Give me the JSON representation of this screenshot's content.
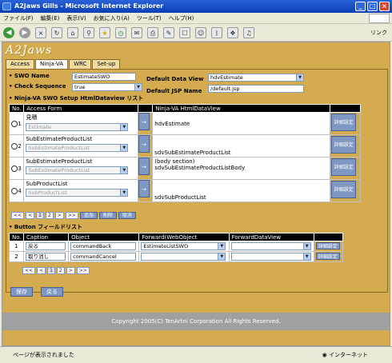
{
  "window": {
    "title": "A2Jaws Gills - Microsoft Internet Explorer"
  },
  "menu": [
    "ファイル(F)",
    "編集(E)",
    "表示(V)",
    "お気に入り(A)",
    "ツール(T)",
    "ヘルプ(H)"
  ],
  "toolbar": {
    "link_label": "リンク"
  },
  "app": {
    "logo": "A2Jaws"
  },
  "tabs": [
    "Access",
    "Ninja-VA",
    "WRC",
    "Set-up"
  ],
  "form": {
    "swo_name_label": "SWO Name",
    "swo_name_value": "EstimateSWO",
    "check_seq_label": "Check Sequence",
    "check_seq_value": "true",
    "default_dataview_label": "Default Data View",
    "default_dataview_value": "hdvEstimate",
    "default_jsp_label": "Default JSP Name",
    "default_jsp_value": "/default.jsp"
  },
  "dataview_section": {
    "title": "Ninja-VA SWO Setup HtmlDataview リスト",
    "headers": [
      "No.",
      "Access Form",
      "Ninja-VA HtmlDataView"
    ],
    "rows": [
      {
        "no": "1",
        "form": "見積",
        "select": "Estimate",
        "view": "hdvEstimate"
      },
      {
        "no": "2",
        "form": "SubEstimateProductList",
        "select": "SubEstimateProductList",
        "view": "sdvSubEstimateProductList"
      },
      {
        "no": "3",
        "form": "SubEstimateProductList",
        "select": "SubEstimateProductList",
        "view": "(body section)\nsdvSubEstimateProductListBody"
      },
      {
        "no": "4",
        "form": "SubProductList",
        "select": "SubProductList",
        "view": "sdvSubProductList"
      }
    ],
    "arrow": "→",
    "detail": "詳細設定",
    "pager": [
      "<<",
      "<",
      "1",
      "2",
      ">",
      ">>"
    ],
    "actions": [
      "追加",
      "削除",
      "取消"
    ]
  },
  "button_section": {
    "title": "Button フィールドリスト",
    "headers": [
      "No.",
      "Caption",
      "Object",
      "Forward(WebObject",
      "ForwardDataView"
    ],
    "rows": [
      {
        "no": "1",
        "caption": "戻る",
        "object": "commandBack",
        "forward": "EstimateListSWO",
        "dataview": ""
      },
      {
        "no": "2",
        "caption": "取り消し",
        "object": "commandCancel",
        "forward": "",
        "dataview": ""
      }
    ],
    "detail": "詳細設定",
    "pager": [
      "<<",
      "<",
      "1",
      "2",
      ">",
      ">>"
    ]
  },
  "nav": {
    "save": "保存",
    "back": "戻る"
  },
  "footer": {
    "copyright": "Copyright 2005(C) TenArtni Corporation All Rights Reserved."
  },
  "status": {
    "text": "ページが表示されました",
    "zone": "インターネット"
  }
}
